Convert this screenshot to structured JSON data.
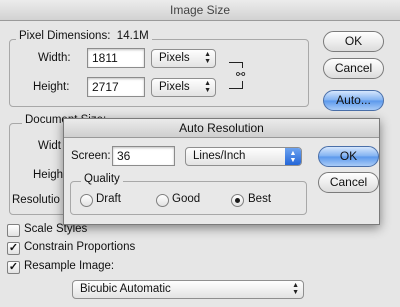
{
  "window": {
    "title": "Image Size"
  },
  "pixel_dimensions": {
    "legend": "Pixel Dimensions:",
    "size": "14.1M",
    "width_label": "Width:",
    "width_value": "1811",
    "width_unit": "Pixels",
    "height_label": "Height:",
    "height_value": "2717",
    "height_unit": "Pixels"
  },
  "buttons": {
    "ok": "OK",
    "cancel": "Cancel",
    "auto": "Auto..."
  },
  "document_size": {
    "legend": "Document Size:",
    "width_label": "Widt",
    "height_label": "Heigh",
    "resolution_label": "Resolutio"
  },
  "options": {
    "scale_styles": "Scale Styles",
    "scale_styles_checked": false,
    "constrain": "Constrain Proportions",
    "constrain_checked": true,
    "resample": "Resample Image:",
    "resample_checked": true,
    "check_mark": "✓",
    "method": "Bicubic Automatic"
  },
  "auto_resolution": {
    "title": "Auto Resolution",
    "screen_label": "Screen:",
    "screen_value": "36",
    "screen_unit": "Lines/Inch",
    "quality_legend": "Quality",
    "draft": "Draft",
    "good": "Good",
    "best": "Best",
    "selected": "Best",
    "ok": "OK",
    "cancel": "Cancel"
  }
}
